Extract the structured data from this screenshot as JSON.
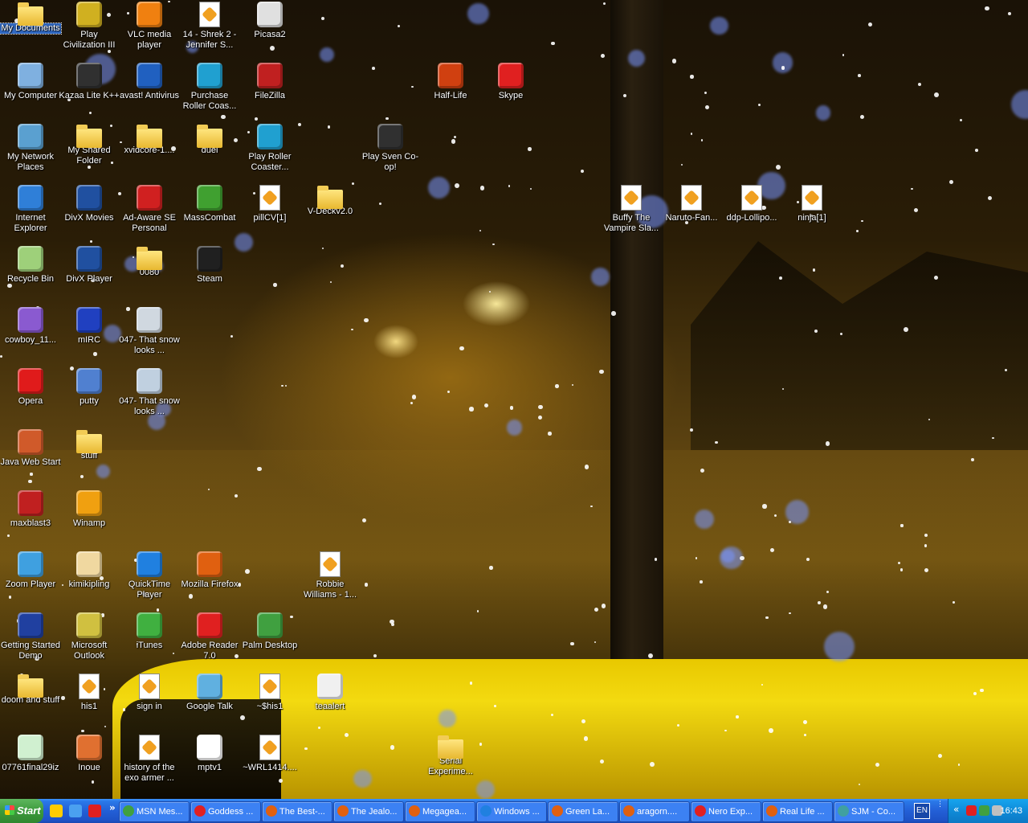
{
  "desktop": {
    "icons": [
      {
        "label": "My Documents",
        "glyph": "folder-documents-icon",
        "color": "#7e9cc8",
        "selected": true
      },
      {
        "label": "My Computer",
        "glyph": "computer-icon",
        "color": "#7fb0e0"
      },
      {
        "label": "My Network Places",
        "glyph": "network-icon",
        "color": "#5aa0d0"
      },
      {
        "label": "Internet Explorer",
        "glyph": "internet-explorer-icon",
        "color": "#2f7fd8"
      },
      {
        "label": "Recycle Bin",
        "glyph": "recycle-bin-icon",
        "color": "#9ed07a"
      },
      {
        "label": "cowboy_11...",
        "glyph": "image-icon",
        "color": "#8a5ad0"
      },
      {
        "label": "Opera",
        "glyph": "opera-icon",
        "color": "#e01b1b"
      },
      {
        "label": "Java Web Start",
        "glyph": "java-icon",
        "color": "#d05a2a"
      },
      {
        "label": "maxblast3",
        "glyph": "maxblast-icon",
        "color": "#c02020"
      },
      {
        "label": "Zoom Player",
        "glyph": "zoom-player-icon",
        "color": "#3fa0e0"
      },
      {
        "label": "Getting Started Demo",
        "glyph": "demo-icon",
        "color": "#2040a0"
      },
      {
        "label": "doom and stuff",
        "glyph": "folder-icon",
        "color": "#f0c040"
      },
      {
        "label": "07761final29iz",
        "glyph": "image-icon",
        "color": "#d0f0d0"
      },
      {
        "label": "Play Civilization III",
        "glyph": "civilization-icon",
        "color": "#d0b020"
      },
      {
        "label": "Kazaa Lite K++",
        "glyph": "kazaa-icon",
        "color": "#303030"
      },
      {
        "label": "My Shared Folder",
        "glyph": "folder-shared-icon",
        "color": "#f0c040"
      },
      {
        "label": "DivX Movies",
        "glyph": "divx-icon",
        "color": "#2050a0"
      },
      {
        "label": "DivX Player",
        "glyph": "divx-icon",
        "color": "#2050a0"
      },
      {
        "label": "mIRC",
        "glyph": "mirc-icon",
        "color": "#2040c0"
      },
      {
        "label": "putty",
        "glyph": "putty-icon",
        "color": "#5080d0"
      },
      {
        "label": "stuff",
        "glyph": "folder-icon",
        "color": "#f0c040"
      },
      {
        "label": "Winamp",
        "glyph": "winamp-icon",
        "color": "#f0a010"
      },
      {
        "label": "kimikipling",
        "glyph": "image-icon",
        "color": "#f0d8a0"
      },
      {
        "label": "Microsoft Outlook",
        "glyph": "outlook-icon",
        "color": "#d0c040"
      },
      {
        "label": "his1",
        "glyph": "document-icon",
        "color": "#ffffff"
      },
      {
        "label": "Inoue",
        "glyph": "image-icon",
        "color": "#e07030"
      },
      {
        "label": "VLC media player",
        "glyph": "vlc-icon",
        "color": "#f08010"
      },
      {
        "label": "avast! Antivirus",
        "glyph": "avast-icon",
        "color": "#2060c0"
      },
      {
        "label": "xvidcore-1....",
        "glyph": "folder-icon",
        "color": "#f0c040"
      },
      {
        "label": "Ad-Aware SE Personal",
        "glyph": "ad-aware-icon",
        "color": "#d02020"
      },
      {
        "label": "0080",
        "glyph": "folder-icon",
        "color": "#f0c040"
      },
      {
        "label": "047- That snow looks ...",
        "glyph": "image-icon",
        "color": "#d0d8e0"
      },
      {
        "label": "047- That snow looks ...",
        "glyph": "image-icon",
        "color": "#c0d0e0"
      },
      {
        "label": "QuickTime Player",
        "glyph": "quicktime-icon",
        "color": "#2080e0"
      },
      {
        "label": "iTunes",
        "glyph": "itunes-icon",
        "color": "#40b040"
      },
      {
        "label": "sign in",
        "glyph": "document-icon",
        "color": "#ffffff"
      },
      {
        "label": "history of the exo armer ...",
        "glyph": "document-icon",
        "color": "#ffffff"
      },
      {
        "label": "14 - Shrek 2 - Jennifer S...",
        "glyph": "audio-file-icon",
        "color": "#ffffff"
      },
      {
        "label": "Purchase Roller Coas...",
        "glyph": "rollercoaster-icon",
        "color": "#20a0d0"
      },
      {
        "label": "duel",
        "glyph": "folder-icon",
        "color": "#f0c040"
      },
      {
        "label": "MassCombat",
        "glyph": "masscombat-icon",
        "color": "#40a030"
      },
      {
        "label": "Steam",
        "glyph": "steam-icon",
        "color": "#202020"
      },
      {
        "label": "Mozilla Firefox",
        "glyph": "firefox-icon",
        "color": "#e06010"
      },
      {
        "label": "Adobe Reader 7.0",
        "glyph": "adobe-reader-icon",
        "color": "#e02020"
      },
      {
        "label": "Google Talk",
        "glyph": "google-talk-icon",
        "color": "#60b0e0"
      },
      {
        "label": "mptv1",
        "glyph": "image-icon",
        "color": "#ffffff"
      },
      {
        "label": "Picasa2",
        "glyph": "picasa-icon",
        "color": "#e0e0e0"
      },
      {
        "label": "FileZilla",
        "glyph": "filezilla-icon",
        "color": "#c02020"
      },
      {
        "label": "Play Roller Coaster...",
        "glyph": "rollercoaster-icon",
        "color": "#20a0d0"
      },
      {
        "label": "pillCV[1]",
        "glyph": "document-icon",
        "color": "#ffffff"
      },
      {
        "label": "Palm Desktop",
        "glyph": "palm-icon",
        "color": "#40a040"
      },
      {
        "label": "~$his1",
        "glyph": "document-icon",
        "color": "#d8d8c0"
      },
      {
        "label": "~WRL1414....",
        "glyph": "document-icon",
        "color": "#d8d8d8"
      },
      {
        "label": "V-Deckv2.0",
        "glyph": "folder-icon",
        "color": "#f0c040"
      },
      {
        "label": "Robbie Williams - 1...",
        "glyph": "audio-file-icon",
        "color": "#ffffff"
      },
      {
        "label": "teaalert",
        "glyph": "image-icon",
        "color": "#f0f0f0"
      },
      {
        "label": "Play Sven Co-op!",
        "glyph": "half-life-icon",
        "color": "#303030"
      },
      {
        "label": "Half-Life",
        "glyph": "half-life-icon",
        "color": "#d04010"
      },
      {
        "label": "Serial Experime...",
        "glyph": "folder-icon",
        "color": "#f0c040"
      },
      {
        "label": "Skype",
        "glyph": "skype-icon",
        "color": "#e02020"
      },
      {
        "label": "Buffy The Vampire Sla...",
        "glyph": "audio-file-icon",
        "color": "#ffffff"
      },
      {
        "label": "Naruto-Fan...",
        "glyph": "audio-file-icon",
        "color": "#ffffff"
      },
      {
        "label": "ddp-Lollipo...",
        "glyph": "audio-file-icon",
        "color": "#ffffff"
      },
      {
        "label": "ninja[1]",
        "glyph": "audio-file-icon",
        "color": "#ffffff"
      }
    ]
  },
  "taskbar": {
    "start_label": "Start",
    "quicklaunch": [
      {
        "icon": "ie-quicklaunch-icon",
        "color": "#ffcc00"
      },
      {
        "icon": "show-desktop-icon",
        "color": "#4aa0f0"
      },
      {
        "icon": "opera-quicklaunch-icon",
        "color": "#e02020"
      }
    ],
    "quicklaunch_more": "»",
    "tasks": [
      {
        "label": "MSN Mes...",
        "color": "#40a040"
      },
      {
        "label": "Goddess ...",
        "color": "#e02020"
      },
      {
        "label": "The Best-...",
        "color": "#e06010"
      },
      {
        "label": "The Jealo...",
        "color": "#e06010"
      },
      {
        "label": "Megagea...",
        "color": "#e06010"
      },
      {
        "label": "Windows ...",
        "color": "#2080e0"
      },
      {
        "label": "Green La...",
        "color": "#e06010"
      },
      {
        "label": "aragorn....",
        "color": "#e06010"
      },
      {
        "label": "Nero Exp...",
        "color": "#e02020"
      },
      {
        "label": "Real Life ...",
        "color": "#e06010"
      },
      {
        "label": "SJM - Co...",
        "color": "#40a0a0"
      }
    ],
    "language": "EN",
    "tray_expand": "«",
    "tray_icons": [
      {
        "icon": "gmail-tray-icon",
        "color": "#e02020"
      },
      {
        "icon": "msn-tray-icon",
        "color": "#40a040"
      },
      {
        "icon": "volume-tray-icon",
        "color": "#c0c0c0"
      }
    ],
    "clock": "16:43"
  }
}
